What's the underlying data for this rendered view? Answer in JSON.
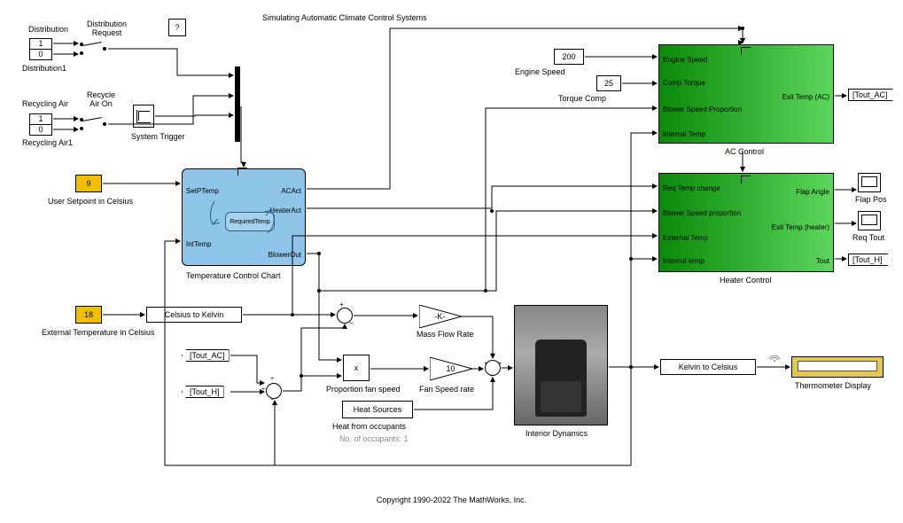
{
  "title": "Simulating Automatic Climate Control Systems",
  "help": "?",
  "copyright": "Copyright 1990-2022 The MathWorks, Inc.",
  "labels": {
    "distribution": "Distribution",
    "distribution_request": "Distribution\nRequest",
    "distribution1": "Distribution1",
    "recycling_air": "Recycling Air",
    "recycle_air_on": "Recycle\nAir On",
    "recycling_air1": "Recycling Air1",
    "system_trigger": "System Trigger",
    "user_setpoint": "User Setpoint in Celsius",
    "ext_temp": "External Temperature in Celsius",
    "temp_chart": "Temperature Control Chart",
    "celsius_to_kelvin": "Celsius to Kelvin",
    "mass_flow_rate": "Mass Flow Rate",
    "proportion_fan": "Proportion fan speed",
    "fan_speed_rate": "Fan Speed rate",
    "heat_sources": "Heat Sources",
    "heat_occupants": "Heat from occupants",
    "no_occupants": "No. of occupants: 1",
    "interior_dynamics": "Interior Dynamics",
    "kelvin_to_celsius": "Kelvin to Celsius",
    "thermo_display": "Thermometer Display",
    "engine_speed": "Engine Speed",
    "torque_comp": "Torque Comp",
    "ac_control": "AC Control",
    "heater_control": "Heater Control",
    "flap_pos": "Flap Pos",
    "req_tout": "Req Tout"
  },
  "values": {
    "dist_top": "1",
    "dist_bot": "0",
    "recy_top": "1",
    "recy_bot": "0",
    "setpoint": "9",
    "ext_temp": "18",
    "engine_speed": "200",
    "torque_comp": "25",
    "gain_k": "-K-",
    "gain_10": "10",
    "prod": "x"
  },
  "chart": {
    "setptemp": "SetPTemp",
    "inttemp": "IntTemp",
    "icon_text": "RequiredTemp",
    "acact": "ACAct",
    "heateract": "HeaterAct",
    "blowerout": "BlowerOut"
  },
  "ac": {
    "engine_speed": "Engine Speed",
    "comp_torque": "Comp Torque",
    "blower": "Blower Speed Proportion",
    "int_temp": "Internal Temp",
    "exit_temp": "Exit Temp (AC)"
  },
  "heater": {
    "req": "Req Temp change",
    "blower": "Blower Speed proportion",
    "ext": "External Temp",
    "int": "Internal temp",
    "flap": "Flap Angle",
    "exit": "Exit Temp (heater)",
    "tout": "Tout"
  },
  "tags": {
    "tout_ac": "[Tout_AC]",
    "tout_h": "[Tout_H]"
  }
}
